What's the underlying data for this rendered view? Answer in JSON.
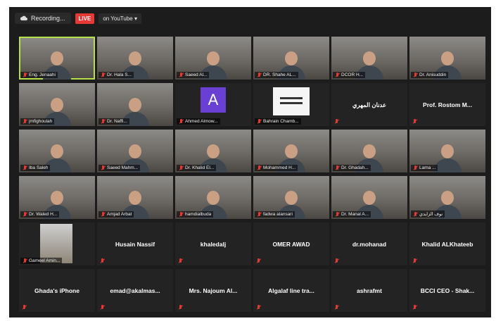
{
  "topbar": {
    "recording_label": "Recording...",
    "live_label": "LIVE",
    "youtube_label": "on YouTube ▾"
  },
  "tiles": [
    {
      "name": "Eng. Jenaahi",
      "kind": "video",
      "active": true
    },
    {
      "name": "Dr. Hala S...",
      "kind": "video"
    },
    {
      "name": "Saeed Al...",
      "kind": "video"
    },
    {
      "name": "DR. Shahe AL...",
      "kind": "video"
    },
    {
      "name": "DCOR H...",
      "kind": "video"
    },
    {
      "name": "Dr. Anisuddin",
      "kind": "video"
    },
    {
      "name": "jmfighoulah",
      "kind": "video"
    },
    {
      "name": "Dr. Naffi...",
      "kind": "video"
    },
    {
      "name": "Ahmed Almow...",
      "kind": "avatar",
      "avatar_letter": "A"
    },
    {
      "name": "Bahrain Chamb...",
      "kind": "logo"
    },
    {
      "name": "عدنان المهري",
      "kind": "name"
    },
    {
      "name": "Prof. Rostom M...",
      "kind": "name"
    },
    {
      "name": "Iba Saleh",
      "kind": "video"
    },
    {
      "name": "Saeed Mahm...",
      "kind": "video"
    },
    {
      "name": "Dr. Khalid El...",
      "kind": "video"
    },
    {
      "name": "Mohammed H...",
      "kind": "video"
    },
    {
      "name": "Dr. Ghadah...",
      "kind": "video"
    },
    {
      "name": "Lama ...",
      "kind": "video"
    },
    {
      "name": "Dr. Waled H...",
      "kind": "video"
    },
    {
      "name": "Amjad Arbat",
      "kind": "video"
    },
    {
      "name": "hamdialbuda",
      "kind": "video"
    },
    {
      "name": "fadwa alansari",
      "kind": "video"
    },
    {
      "name": "Dr. Manal A...",
      "kind": "video"
    },
    {
      "name": "نوف الزايدي",
      "kind": "video"
    },
    {
      "name": "Gameel Amin...",
      "kind": "inset"
    },
    {
      "name": "Husain Nassif",
      "kind": "name"
    },
    {
      "name": "khaledalj",
      "kind": "name"
    },
    {
      "name": "OMER AWAD",
      "kind": "name"
    },
    {
      "name": "dr.mohanad",
      "kind": "name"
    },
    {
      "name": "Khalid ALKhateeb",
      "kind": "name"
    },
    {
      "name": "Ghada's iPhone",
      "kind": "name"
    },
    {
      "name": "emad@akalmas...",
      "kind": "name"
    },
    {
      "name": "Mrs. Najoum Al...",
      "kind": "name"
    },
    {
      "name": "Algalaf line tra...",
      "kind": "name"
    },
    {
      "name": "ashrafmt",
      "kind": "name"
    },
    {
      "name": "BCCI CEO - Shak...",
      "kind": "name"
    }
  ],
  "colors": {
    "background": "#1c1c1c",
    "tile": "#232323",
    "active_speaker": "#b8e04a",
    "live": "#e53935",
    "avatar": "#6a3fd3"
  }
}
